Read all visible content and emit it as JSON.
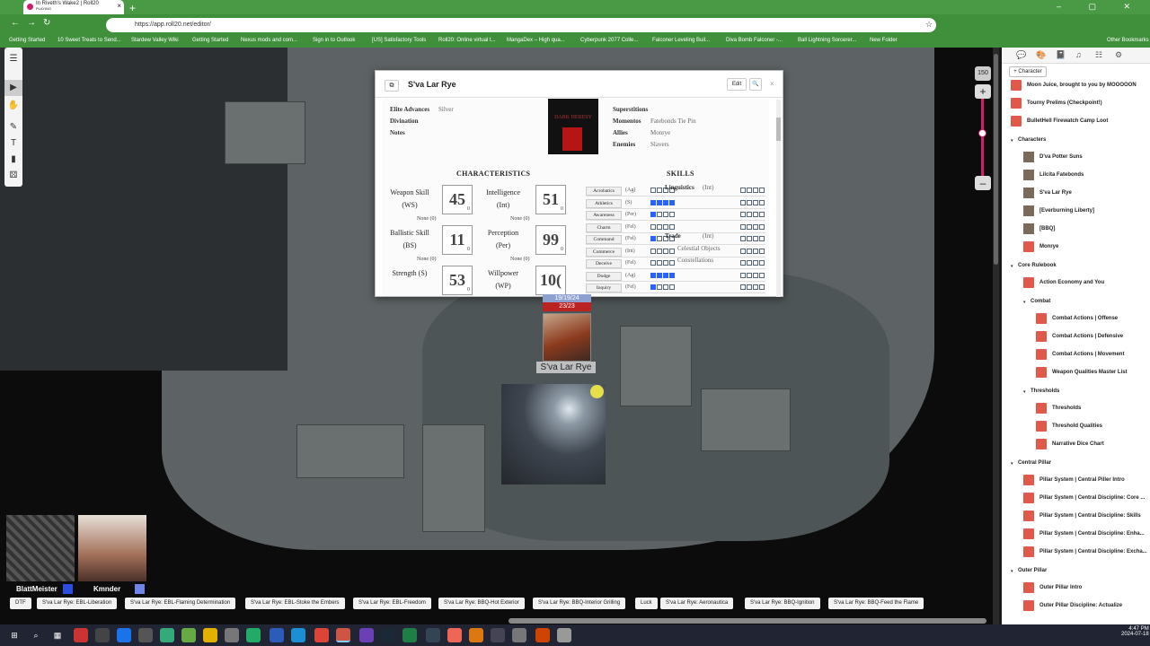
{
  "browser": {
    "tab_title": "In Riveth's Wake2 | Roll20",
    "tab_subtitle": "PLAYING",
    "url": "https://app.roll20.net/editor/",
    "bookmarks": [
      "Getting Started",
      "10 Sweet Treats to Send...",
      "Stardew Valley Wiki",
      "Getting Started",
      "Nexus mods and com...",
      "Sign in to Outlook",
      "[US] Satisfactory Tools",
      "Roll20: Online virtual t...",
      "MangaDex – High qua...",
      "Cyberpunk 2077 Colle...",
      "Falconer Leveling Buil...",
      "Diva Bomb Falconer -...",
      "Ball Lightning Sorcerer...",
      "New Folder"
    ],
    "other_bookmarks": "Other Bookmarks"
  },
  "zoom": {
    "level": "150"
  },
  "sheet": {
    "title": "S'va Lar Rye",
    "edit_label": "Edit",
    "top_fields": [
      {
        "label": "Elite Advances",
        "value": "Silver"
      },
      {
        "label": "Divination",
        "value": ""
      },
      {
        "label": "Notes",
        "value": ""
      }
    ],
    "right_fields": [
      {
        "label": "Superstitions",
        "value": ""
      },
      {
        "label": "Momentos",
        "value": "Fatebonds Tie Pin"
      },
      {
        "label": "Allies",
        "value": "Monrye"
      },
      {
        "label": "Enemies",
        "value": "Slavers"
      }
    ],
    "logo_text": "DARK HERESY",
    "characteristics_heading": "CHARACTERISTICS",
    "skills_heading": "SKILLS",
    "characteristics": [
      {
        "label": "Weapon Skill (WS)",
        "value": "45",
        "mod": "0",
        "adv": "None (0)"
      },
      {
        "label": "Intelligence (Int)",
        "value": "51",
        "mod": "0",
        "adv": "None (0)"
      },
      {
        "label": "Ballistic Skill (BS)",
        "value": "11",
        "mod": "0",
        "adv": "None (0)"
      },
      {
        "label": "Perception (Per)",
        "value": "99",
        "mod": "0",
        "adv": "None (0)"
      },
      {
        "label": "Strength (S)",
        "value": "53",
        "mod": "0",
        "adv": ""
      },
      {
        "label": "Willpower (WP)",
        "value": "10(",
        "mod": "",
        "adv": ""
      }
    ],
    "skills": [
      {
        "name": "Acrobatics",
        "char": "(Ag)",
        "checks": [
          false,
          false,
          false,
          false
        ]
      },
      {
        "name": "Athletics",
        "char": "(S)",
        "checks": [
          true,
          true,
          true,
          true
        ]
      },
      {
        "name": "Awareness",
        "char": "(Per)",
        "checks": [
          true,
          false,
          false,
          false
        ]
      },
      {
        "name": "Charm",
        "char": "(Fel)",
        "checks": [
          false,
          false,
          false,
          false
        ]
      },
      {
        "name": "Command",
        "char": "(Fel)",
        "checks": [
          true,
          false,
          false,
          false
        ]
      },
      {
        "name": "Commerce",
        "char": "(Int)",
        "checks": [
          false,
          false,
          false,
          false
        ]
      },
      {
        "name": "Deceive",
        "char": "(Fel)",
        "checks": [
          false,
          false,
          false,
          false
        ]
      },
      {
        "name": "Dodge",
        "char": "(Ag)",
        "checks": [
          true,
          true,
          true,
          true
        ]
      },
      {
        "name": "Inquiry",
        "char": "(Fel)",
        "checks": [
          true,
          false,
          false,
          false
        ]
      }
    ],
    "linguistics": {
      "label": "Linguistics",
      "char": "(Int)"
    },
    "trade": {
      "label": "Trade",
      "char": "(Int)",
      "subs": [
        "Celestial Objects",
        "Constellations"
      ]
    }
  },
  "token": {
    "name": "S'va Lar Rye",
    "hp": "23/23",
    "bar_top": "19/19/24"
  },
  "players": [
    {
      "name": "BlattMeister",
      "color": "#2a4fe0"
    },
    {
      "name": "Kmnder",
      "color": "#6f86e8"
    }
  ],
  "macros": [
    "DTF",
    "S'va Lar Rye: EBL-Liberation",
    "S'va Lar Rye: EBL-Flaming Determination",
    "S'va Lar Rye: EBL-Stoke the Embers",
    "S'va Lar Rye: EBL-Freedom",
    "S'va Lar Rye: BBQ-Hot Exterior",
    "S'va Lar Rye: BBQ-Interior Grilling",
    "Luck",
    "S'va Lar Rye: Aeronautica",
    "S'va Lar Rye: BBQ-Ignition",
    "S'va Lar Rye: BBQ-Feed the Flame"
  ],
  "journal": {
    "add_character": "+ Character",
    "items": [
      {
        "type": "handout",
        "label": "Moon Juice, brought to you by MOOOOON",
        "indent": 0
      },
      {
        "type": "handout",
        "label": "Tourny Prelims (Checkpoint!)",
        "indent": 0
      },
      {
        "type": "handout",
        "label": "BulletHell Firewatch Camp Loot",
        "indent": 0
      },
      {
        "type": "folder",
        "label": "Characters",
        "indent": 0
      },
      {
        "type": "char",
        "label": "D'va Potter Suns",
        "indent": 1
      },
      {
        "type": "char",
        "label": "Lilcita Fatebonds",
        "indent": 1
      },
      {
        "type": "char",
        "label": "S'va Lar Rye",
        "indent": 1
      },
      {
        "type": "char",
        "label": "[Everburning Liberty]",
        "indent": 1
      },
      {
        "type": "char",
        "label": "[BBQ]",
        "indent": 1
      },
      {
        "type": "handout",
        "label": "Monrye",
        "indent": 1
      },
      {
        "type": "folder",
        "label": "Core Rulebook",
        "indent": 0
      },
      {
        "type": "handout",
        "label": "Action Economy and You",
        "indent": 1
      },
      {
        "type": "folder",
        "label": "Combat",
        "indent": 1
      },
      {
        "type": "handout",
        "label": "Combat Actions | Offense",
        "indent": 2
      },
      {
        "type": "handout",
        "label": "Combat Actions | Defensive",
        "indent": 2
      },
      {
        "type": "handout",
        "label": "Combat Actions | Movement",
        "indent": 2
      },
      {
        "type": "handout",
        "label": "Weapon Qualities Master List",
        "indent": 2
      },
      {
        "type": "folder",
        "label": "Thresholds",
        "indent": 1
      },
      {
        "type": "handout",
        "label": "Thresholds",
        "indent": 2
      },
      {
        "type": "handout",
        "label": "Threshold Qualities",
        "indent": 2
      },
      {
        "type": "handout",
        "label": "Narrative Dice Chart",
        "indent": 2
      },
      {
        "type": "folder",
        "label": "Central Pillar",
        "indent": 0
      },
      {
        "type": "handout",
        "label": "Pillar System | Central Piller Intro",
        "indent": 1
      },
      {
        "type": "handout",
        "label": "Pillar System | Central Discipline: Core ...",
        "indent": 1
      },
      {
        "type": "handout",
        "label": "Pillar System | Central Discipline: Skills",
        "indent": 1
      },
      {
        "type": "handout",
        "label": "Pillar System | Central Discipline: Enha...",
        "indent": 1
      },
      {
        "type": "handout",
        "label": "Pillar System | Central Discipline: Excha...",
        "indent": 1
      },
      {
        "type": "folder",
        "label": "Outer Pillar",
        "indent": 0
      },
      {
        "type": "handout",
        "label": "Outer Pillar Intro",
        "indent": 1
      },
      {
        "type": "handout",
        "label": "Outer Pillar Discipline: Actualize",
        "indent": 1
      }
    ]
  },
  "clock": {
    "time": "4:47 PM",
    "date": "2024-07-18"
  }
}
